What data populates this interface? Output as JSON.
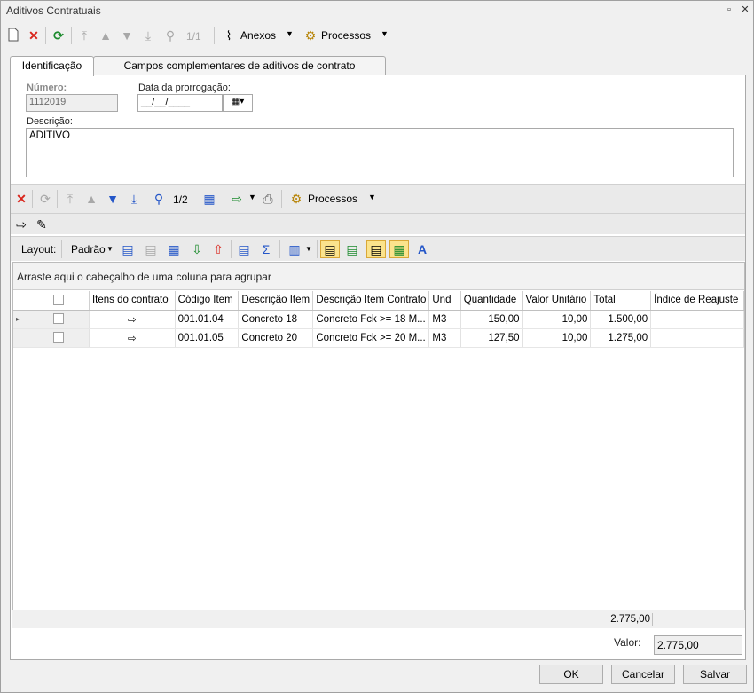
{
  "window": {
    "title": "Aditivos Contratuais"
  },
  "top_toolbar": {
    "record_counter": "1/1",
    "anexos_label": "Anexos",
    "processos_label": "Processos"
  },
  "tabs": [
    {
      "label": "Identificação"
    },
    {
      "label": "Campos complementares de aditivos de contrato"
    }
  ],
  "form": {
    "numero_label": "Número:",
    "numero_value": "1112019",
    "data_label": "Data da prorrogação:",
    "data_value": "__/__/____",
    "descricao_label": "Descrição:",
    "descricao_value": "ADITIVO"
  },
  "grid_toolbar": {
    "record_counter": "1/2",
    "processos_label": "Processos"
  },
  "layout_bar": {
    "layout_label": "Layout:",
    "padrao_label": "Padrão"
  },
  "grid": {
    "group_hint": "Arraste aqui o cabeçalho de uma coluna para agrupar",
    "columns": [
      "Itens do contrato",
      "Código Item",
      "Descrição Item",
      "Descrição Item Contrato",
      "Und",
      "Quantidade",
      "Valor Unitário",
      "Total",
      "Índice de Reajuste"
    ],
    "rows": [
      {
        "codigo": "001.01.04",
        "descricao": "Concreto 18",
        "descricao_contrato": "Concreto Fck >= 18 M...",
        "und": "M3",
        "quantidade": "150,00",
        "valor_unitario": "10,00",
        "total": "1.500,00",
        "indice": ""
      },
      {
        "codigo": "001.01.05",
        "descricao": "Concreto 20",
        "descricao_contrato": "Concreto Fck >= 20 M...",
        "und": "M3",
        "quantidade": "127,50",
        "valor_unitario": "10,00",
        "total": "1.275,00",
        "indice": ""
      }
    ],
    "total_sum": "2.775,00"
  },
  "valor": {
    "label": "Valor:",
    "value": "2.775,00"
  },
  "buttons": {
    "ok": "OK",
    "cancelar": "Cancelar",
    "salvar": "Salvar"
  }
}
